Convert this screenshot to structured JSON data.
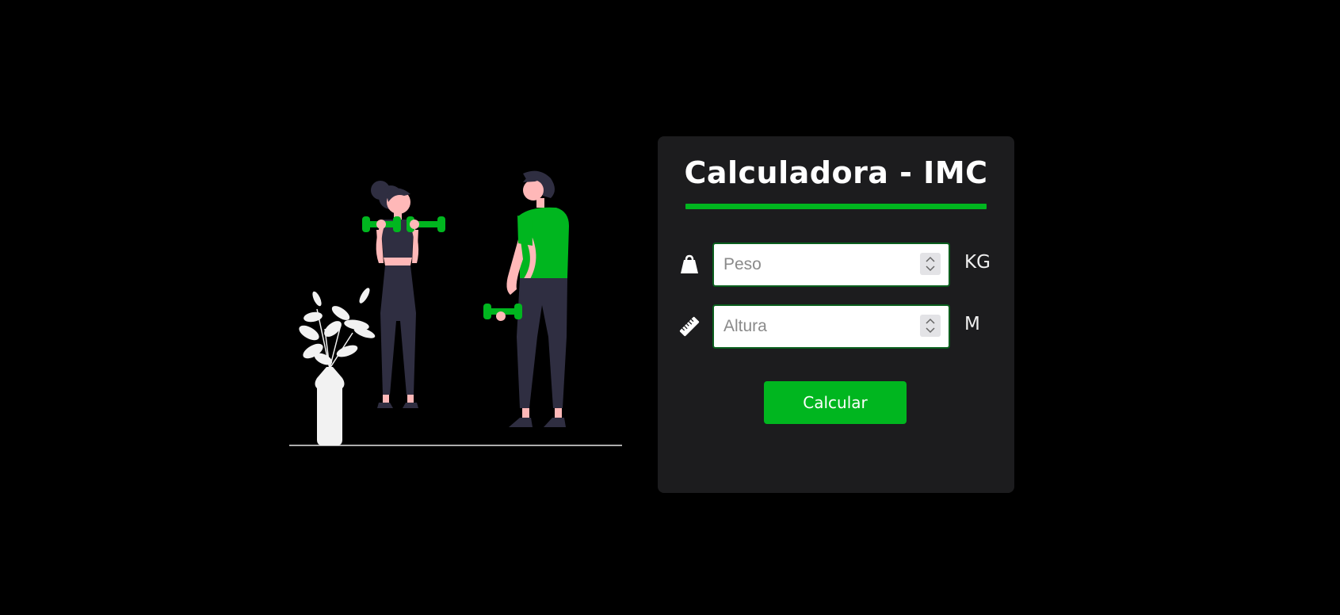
{
  "colors": {
    "background": "#000000",
    "card": "#1c1c1e",
    "accent": "#00b61f",
    "skin": "#ffb8b8",
    "dark_clothing": "#2f2e41",
    "plant": "#f2f2f2"
  },
  "card": {
    "title": "Calculadora - IMC"
  },
  "fields": {
    "peso": {
      "icon": "weight-icon",
      "placeholder": "Peso",
      "value": "",
      "unit": "KG"
    },
    "altura": {
      "icon": "ruler-icon",
      "placeholder": "Altura",
      "value": "",
      "unit": "M"
    }
  },
  "button": {
    "label": "Calcular"
  },
  "illustration": {
    "icon": "workout-illustration"
  }
}
